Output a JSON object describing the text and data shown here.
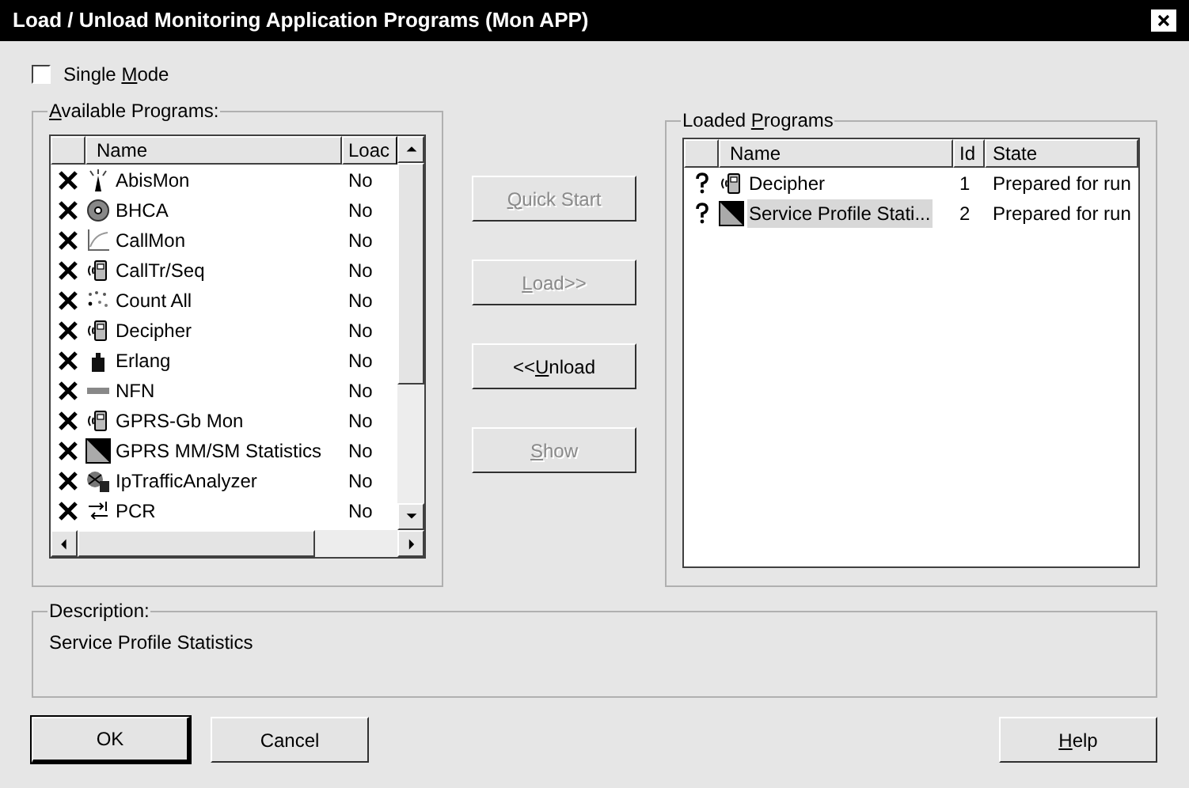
{
  "window": {
    "title": "Load / Unload Monitoring Application Programs (Mon APP)"
  },
  "single_mode": {
    "label": {
      "pre": "Single ",
      "key": "M",
      "post": "ode"
    },
    "checked": false
  },
  "available": {
    "legend": {
      "key": "A",
      "post": "vailable Programs:"
    },
    "columns": [
      "Name",
      "Loac"
    ],
    "rows": [
      {
        "prepared": false,
        "kind": "antenna",
        "name": "AbisMon",
        "loaded": "No"
      },
      {
        "prepared": false,
        "kind": "disc",
        "name": "BHCA",
        "loaded": "No"
      },
      {
        "prepared": false,
        "kind": "graph",
        "name": "CallMon",
        "loaded": "No"
      },
      {
        "prepared": false,
        "kind": "phone",
        "name": "CallTr/Seq",
        "loaded": "No"
      },
      {
        "prepared": false,
        "kind": "dots",
        "name": "Count All",
        "loaded": "No"
      },
      {
        "prepared": false,
        "kind": "phone",
        "name": "Decipher",
        "loaded": "No"
      },
      {
        "prepared": false,
        "kind": "weight",
        "name": "Erlang",
        "loaded": "No"
      },
      {
        "prepared": false,
        "kind": "label",
        "name": "NFN",
        "loaded": "No"
      },
      {
        "prepared": false,
        "kind": "phone",
        "name": "GPRS-Gb Mon",
        "loaded": "No"
      },
      {
        "prepared": false,
        "kind": "statistics",
        "name": "GPRS MM/SM Statistics",
        "loaded": "No"
      },
      {
        "prepared": false,
        "kind": "network",
        "name": "IpTrafficAnalyzer",
        "loaded": "No"
      },
      {
        "prepared": false,
        "kind": "arrows",
        "name": "PCR",
        "loaded": "No"
      }
    ]
  },
  "actions": [
    {
      "key": "Q",
      "post": "uick Start",
      "disabled": true
    },
    {
      "key": "L",
      "post": "oad>>",
      "disabled": true
    },
    {
      "pre": "<<",
      "key": "U",
      "post": "nload",
      "disabled": false
    },
    {
      "key": "S",
      "post": "how",
      "disabled": true
    }
  ],
  "loaded": {
    "legend": {
      "pre": "Loaded ",
      "key": "P",
      "post": "rograms"
    },
    "columns": [
      "Name",
      "Id",
      "State"
    ],
    "rows": [
      {
        "prepared": true,
        "kind": "phone",
        "name": "Decipher",
        "id": "1",
        "state": "Prepared for run",
        "selected": false
      },
      {
        "prepared": true,
        "kind": "statistics",
        "name": "Service Profile Stati...",
        "id": "2",
        "state": "Prepared for run",
        "selected": true
      }
    ]
  },
  "description": {
    "legend": "Description:",
    "text": "Service Profile Statistics"
  },
  "buttons": [
    {
      "post": "OK",
      "default": true
    },
    {
      "post": "Cancel",
      "default": false
    },
    {
      "key": "H",
      "post": "elp",
      "default": false
    }
  ]
}
